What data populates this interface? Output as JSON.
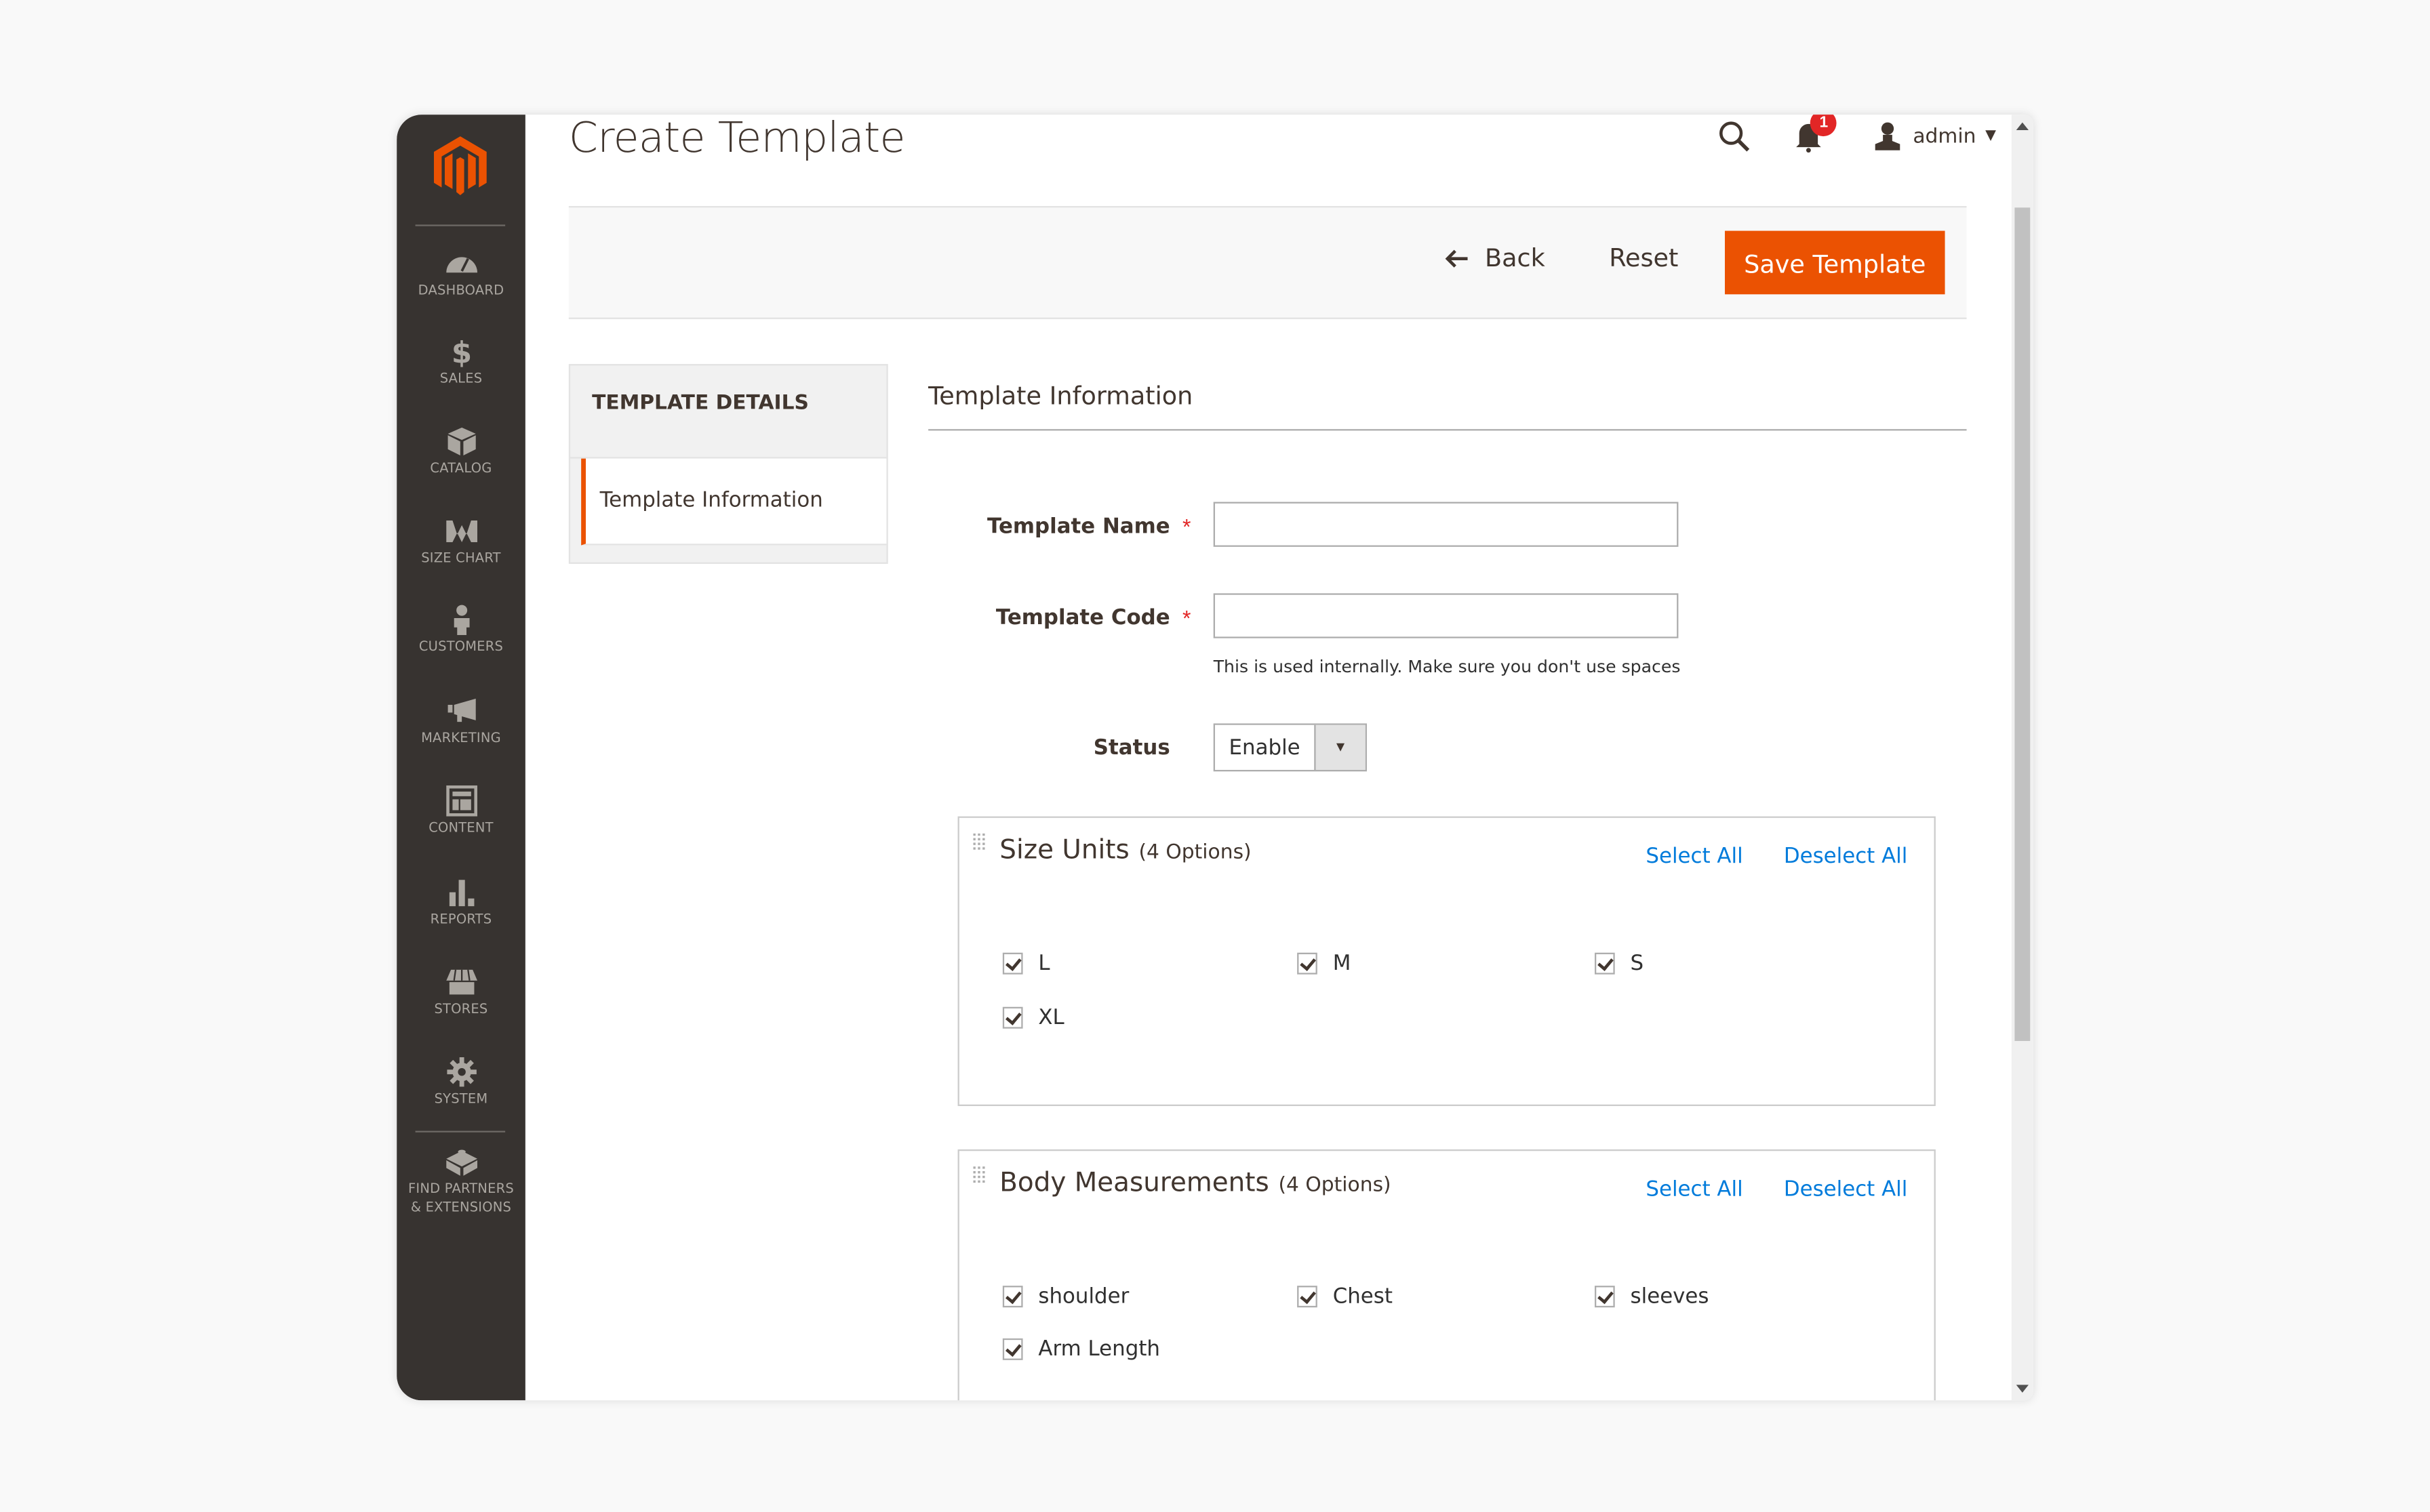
{
  "sidebar": {
    "logo": "magento-logo",
    "items": [
      {
        "label": "DASHBOARD",
        "icon": "dashboard-icon"
      },
      {
        "label": "SALES",
        "icon": "dollar-icon"
      },
      {
        "label": "CATALOG",
        "icon": "box-icon"
      },
      {
        "label": "SIZE CHART",
        "icon": "size-chart-icon"
      },
      {
        "label": "CUSTOMERS",
        "icon": "person-icon"
      },
      {
        "label": "MARKETING",
        "icon": "megaphone-icon"
      },
      {
        "label": "CONTENT",
        "icon": "layout-icon"
      },
      {
        "label": "REPORTS",
        "icon": "bar-chart-icon"
      },
      {
        "label": "STORES",
        "icon": "storefront-icon"
      },
      {
        "label": "SYSTEM",
        "icon": "gear-icon"
      },
      {
        "label": "FIND PARTNERS",
        "label2": "& EXTENSIONS",
        "icon": "blocks-icon"
      }
    ]
  },
  "header": {
    "title": "Create Template",
    "notifications_count": "1",
    "user": "admin"
  },
  "actions": {
    "back": "Back",
    "reset": "Reset",
    "save": "Save Template"
  },
  "colors": {
    "accent": "#eb5202",
    "link": "#007bdb",
    "sidebar_bg": "#373330",
    "required": "#e22626"
  },
  "tabs": {
    "title": "TEMPLATE DETAILS",
    "items": [
      {
        "label": "Template Information",
        "active": true
      }
    ]
  },
  "form": {
    "section_title": "Template Information",
    "template_name": {
      "label": "Template Name",
      "value": "",
      "required": true
    },
    "template_code": {
      "label": "Template Code",
      "value": "",
      "required": true,
      "note": "This is used internally. Make sure you don't use spaces"
    },
    "status": {
      "label": "Status",
      "value": "Enable"
    }
  },
  "groups": [
    {
      "title": "Size Units",
      "count": "(4 Options)",
      "select_all": "Select All",
      "deselect_all": "Deselect All",
      "options": [
        {
          "label": "L",
          "checked": true
        },
        {
          "label": "M",
          "checked": true
        },
        {
          "label": "S",
          "checked": true
        },
        {
          "label": "XL",
          "checked": true
        }
      ]
    },
    {
      "title": "Body Measurements",
      "count": "(4 Options)",
      "select_all": "Select All",
      "deselect_all": "Deselect All",
      "options": [
        {
          "label": "shoulder",
          "checked": true
        },
        {
          "label": "Chest",
          "checked": true
        },
        {
          "label": "sleeves",
          "checked": true
        },
        {
          "label": "Arm Length",
          "checked": true
        }
      ]
    }
  ]
}
